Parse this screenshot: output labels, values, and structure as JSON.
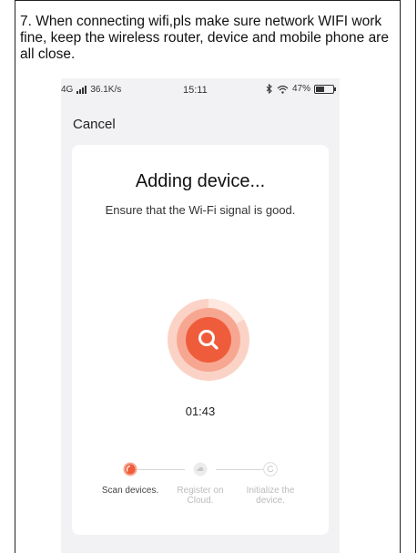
{
  "instruction": "7. When connecting wifi,pls make sure network WIFI work fine, keep the wireless router, device and mobile phone are all close.",
  "status_bar": {
    "network": "4G",
    "speed": "36.1K/s",
    "time": "15:11",
    "battery": "47%",
    "battery_level": 0.47,
    "icons": [
      "signal-icon",
      "bluetooth-icon",
      "wifi-icon",
      "battery-icon"
    ]
  },
  "header": {
    "cancel_label": "Cancel"
  },
  "card": {
    "title": "Adding device...",
    "subtitle": "Ensure that the Wi-Fi signal is good.",
    "timer": "01:43"
  },
  "steps": [
    {
      "label": "Scan devices.",
      "state": "active"
    },
    {
      "label": "Register on Cloud.",
      "state": "pending"
    },
    {
      "label": "Initialize the device.",
      "state": "pending"
    }
  ],
  "colors": {
    "accent": "#ef5c3b",
    "accent_light": "#f7a791",
    "accent_lighter": "#fbd3c6",
    "pending": "#d0d0d0",
    "pending_text": "#bbbbbb",
    "active_text": "#444444"
  }
}
